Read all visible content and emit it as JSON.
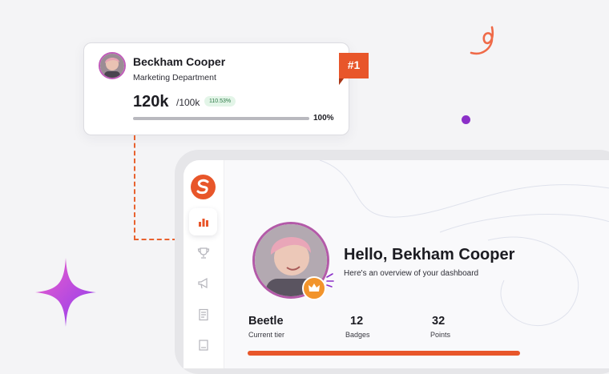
{
  "leaderboard_card": {
    "name": "Beckham Cooper",
    "department": "Marketing Department",
    "value": "120k",
    "target": "/100k",
    "growth_badge": "110.53%",
    "progress_label": "100%",
    "progress_fraction": 1.0
  },
  "rank": {
    "label": "#1"
  },
  "dashboard": {
    "greeting": "Hello, Bekham Cooper",
    "subtitle": "Here's an overview of your dashboard",
    "stats": [
      {
        "value": "Beetle",
        "label": "Current tier"
      },
      {
        "value": "12",
        "label": "Badges"
      },
      {
        "value": "32",
        "label": "Points"
      }
    ],
    "sidebar_icons": [
      "bar-chart-icon",
      "trophy-icon",
      "megaphone-icon",
      "document-icon",
      "book-icon"
    ]
  },
  "colors": {
    "accent": "#e8562a",
    "purple": "#8b2fc8",
    "success_bg": "#e3f5e8",
    "success_text": "#2d7a47"
  }
}
